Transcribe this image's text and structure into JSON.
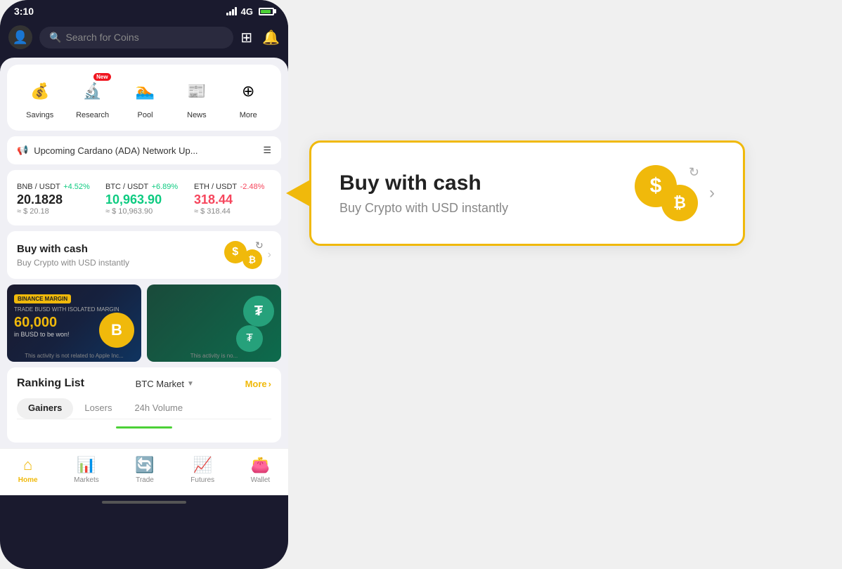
{
  "status": {
    "time": "3:10",
    "signal": "4G",
    "battery_pct": 80
  },
  "search": {
    "placeholder": "Search for Coins"
  },
  "quick_actions": [
    {
      "id": "savings",
      "label": "Savings",
      "icon": "💰",
      "new": false
    },
    {
      "id": "research",
      "label": "Research",
      "icon": "🔬",
      "new": true
    },
    {
      "id": "pool",
      "label": "Pool",
      "icon": "🏊",
      "new": false
    },
    {
      "id": "news",
      "label": "News",
      "icon": "📰",
      "new": false
    },
    {
      "id": "more",
      "label": "More",
      "icon": "⊕",
      "new": false
    }
  ],
  "announcement": {
    "text": "Upcoming Cardano (ADA) Network Up...",
    "icon": "📢"
  },
  "tickers": [
    {
      "pair": "BNB / USDT",
      "change": "+4.52%",
      "positive": true,
      "price": "20.1828",
      "usd": "≈ $ 20.18"
    },
    {
      "pair": "BTC / USDT",
      "change": "+6.89%",
      "positive": true,
      "price": "10,963.90",
      "usd": "≈ $ 10,963.90"
    },
    {
      "pair": "ETH / USDT",
      "change": "-2.48%",
      "positive": false,
      "price": "318.44",
      "usd": "≈ $ 318.44"
    }
  ],
  "buy_cash": {
    "title": "Buy with cash",
    "subtitle": "Buy Crypto with USD instantly"
  },
  "banners": [
    {
      "id": "margin",
      "brand": "BINANCE MARGIN",
      "sublabel": "TRADE BUSD WITH ISOLATED MARGIN",
      "amount": "60,000",
      "amount_sub": "in BUSD to be won!",
      "disclaimer": "This activity is not related to Apple Inc..."
    },
    {
      "id": "tether",
      "disclaimer": "This activity is no..."
    }
  ],
  "ranking": {
    "title": "Ranking List",
    "filter": "BTC Market",
    "more_label": "More",
    "tabs": [
      {
        "id": "gainers",
        "label": "Gainers",
        "active": true
      },
      {
        "id": "losers",
        "label": "Losers",
        "active": false
      },
      {
        "id": "volume",
        "label": "24h Volume",
        "active": false
      }
    ]
  },
  "bottom_nav": [
    {
      "id": "home",
      "label": "Home",
      "icon": "🏠",
      "active": true
    },
    {
      "id": "markets",
      "label": "Markets",
      "icon": "📊",
      "active": false
    },
    {
      "id": "trade",
      "label": "Trade",
      "icon": "🔄",
      "active": false
    },
    {
      "id": "futures",
      "label": "Futures",
      "icon": "📈",
      "active": false
    },
    {
      "id": "wallet",
      "label": "Wallet",
      "icon": "👛",
      "active": false
    }
  ],
  "callout": {
    "title": "Buy with cash",
    "subtitle": "Buy Crypto with USD instantly"
  }
}
